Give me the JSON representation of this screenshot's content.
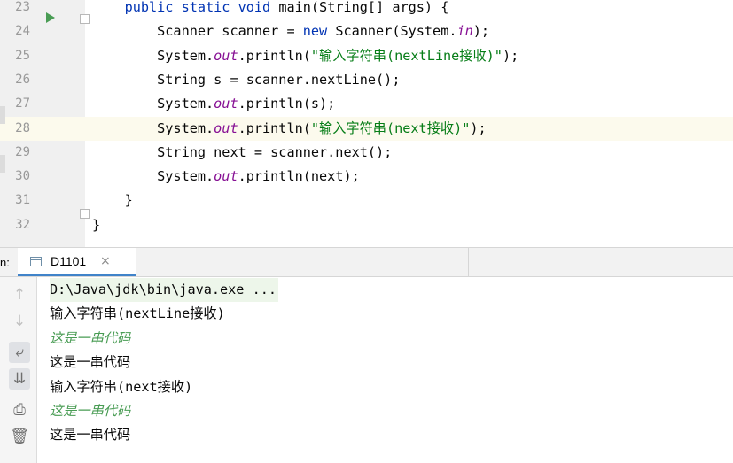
{
  "editor": {
    "lines": [
      {
        "num": "23",
        "tokens": [
          {
            "t": "    "
          },
          {
            "t": "public ",
            "c": "kw"
          },
          {
            "t": "static ",
            "c": "kw"
          },
          {
            "t": "void ",
            "c": "kw"
          },
          {
            "t": "main(String[] args) {"
          }
        ]
      },
      {
        "num": "24",
        "tokens": [
          {
            "t": "        Scanner scanner = "
          },
          {
            "t": "new ",
            "c": "kw"
          },
          {
            "t": "Scanner(System."
          },
          {
            "t": "in",
            "c": "static-f"
          },
          {
            "t": ");"
          }
        ]
      },
      {
        "num": "25",
        "tokens": [
          {
            "t": "        System."
          },
          {
            "t": "out",
            "c": "static-f"
          },
          {
            "t": ".println("
          },
          {
            "t": "\"输入字符串(nextLine接收)\"",
            "c": "str"
          },
          {
            "t": ");"
          }
        ]
      },
      {
        "num": "26",
        "tokens": [
          {
            "t": "        String s = scanner.nextLine();"
          }
        ]
      },
      {
        "num": "27",
        "tokens": [
          {
            "t": "        System."
          },
          {
            "t": "out",
            "c": "static-f"
          },
          {
            "t": ".println(s);"
          }
        ]
      },
      {
        "num": "28",
        "current": true,
        "tokens": [
          {
            "t": "        System."
          },
          {
            "t": "out",
            "c": "static-f"
          },
          {
            "t": ".println("
          },
          {
            "t": "\"输入字符串(next接收)\"",
            "c": "str"
          },
          {
            "t": ");"
          }
        ]
      },
      {
        "num": "29",
        "tokens": [
          {
            "t": "        String next = scanner.next();"
          }
        ]
      },
      {
        "num": "30",
        "tokens": [
          {
            "t": "        System."
          },
          {
            "t": "out",
            "c": "static-f"
          },
          {
            "t": ".println(next);"
          }
        ]
      },
      {
        "num": "31",
        "tokens": [
          {
            "t": "    }"
          }
        ]
      },
      {
        "num": "32",
        "tokens": [
          {
            "t": "}"
          }
        ]
      }
    ]
  },
  "run_panel": {
    "label": "n:",
    "tab_title": "D1101",
    "tab_close": "×"
  },
  "toolbar": {
    "icons": [
      {
        "name": "arrow-up-icon",
        "glyph": "↑",
        "dim": true
      },
      {
        "name": "arrow-down-icon",
        "glyph": "↓",
        "dim": true
      },
      {
        "name": "soft-wrap-icon",
        "glyph": "⤶",
        "active": true
      },
      {
        "name": "scroll-to-end-icon",
        "glyph": "⇊",
        "active": true
      },
      {
        "name": "print-icon",
        "glyph": "⎙"
      },
      {
        "name": "trash-icon",
        "glyph": "🗑"
      }
    ]
  },
  "console": {
    "lines": [
      {
        "text": "D:\\Java\\jdk\\bin\\java.exe ...",
        "type": "cmd"
      },
      {
        "text": "输入字符串(nextLine接收)",
        "type": "out"
      },
      {
        "text": "这是一串代码",
        "type": "input"
      },
      {
        "text": "这是一串代码",
        "type": "out"
      },
      {
        "text": "输入字符串(next接收)",
        "type": "out"
      },
      {
        "text": "这是一串代码",
        "type": "input"
      },
      {
        "text": "这是一串代码",
        "type": "out"
      }
    ]
  },
  "colors": {
    "keyword": "#0033b3",
    "string": "#067d17",
    "static_field": "#871094",
    "user_input": "#499c54",
    "current_line": "#fcfaed"
  }
}
